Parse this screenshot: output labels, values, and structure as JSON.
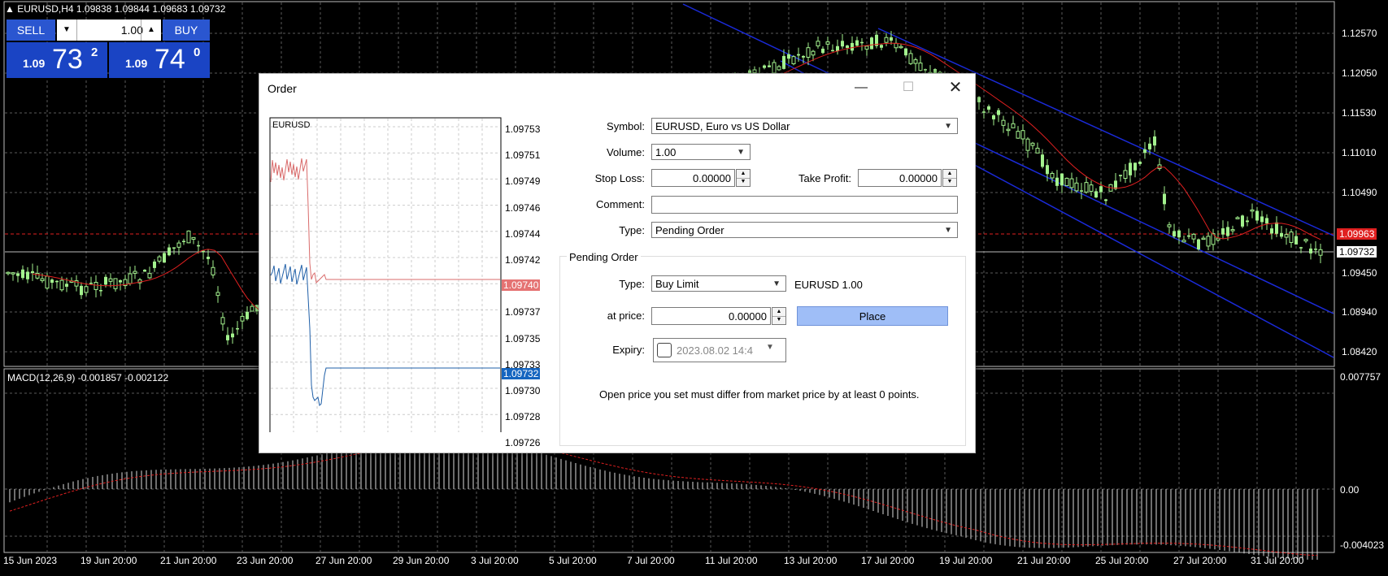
{
  "chart": {
    "header": "▲ EURUSD,H4  1.09838 1.09844 1.09683 1.09732",
    "macd_header": "MACD(12,26,9) -0.001857 -0.002122",
    "price_axis": [
      "1.12570",
      "1.12050",
      "1.11530",
      "1.11010",
      "1.10490",
      "1.09450",
      "1.08940",
      "1.08420"
    ],
    "red_price_tag": "1.09963",
    "white_price_tag": "1.09732",
    "macd_axis": [
      "0.007757",
      "0.00",
      "-0.004023"
    ],
    "time_axis": [
      "15 Jun 2023",
      "19 Jun 20:00",
      "21 Jun 20:00",
      "23 Jun 20:00",
      "27 Jun 20:00",
      "29 Jun 20:00",
      "3 Jul 20:00",
      "5 Jul 20:00",
      "7 Jul 20:00",
      "11 Jul 20:00",
      "13 Jul 20:00",
      "17 Jul 20:00",
      "19 Jul 20:00",
      "21 Jul 20:00",
      "25 Jul 20:00",
      "27 Jul 20:00",
      "31 Jul 20:00"
    ],
    "colors": {
      "bull": "#a3f28e",
      "bear": "#a3f28e",
      "ma": "#e02020",
      "channel": "#1a2ad8",
      "grid": "#5a5a5a"
    }
  },
  "oneclick": {
    "sell_label": "SELL",
    "buy_label": "BUY",
    "lot": "1.00",
    "sell_small": "1.09",
    "sell_big": "73",
    "sell_sup": "2",
    "buy_small": "1.09",
    "buy_big": "74",
    "buy_sup": "0"
  },
  "dialog": {
    "title": "Order",
    "mini_chart": {
      "symbol": "EURUSD",
      "ticks": [
        "1.09753",
        "1.09751",
        "1.09749",
        "1.09746",
        "1.09744",
        "1.09742",
        "1.09740",
        "1.09737",
        "1.09735",
        "1.09733",
        "1.09730",
        "1.09728",
        "1.09726"
      ],
      "ask_tag": "1.09740",
      "bid_tag": "1.09732"
    },
    "symbol_label": "Symbol:",
    "symbol_value": "EURUSD, Euro vs US Dollar",
    "volume_label": "Volume:",
    "volume_value": "1.00",
    "stop_loss_label": "Stop Loss:",
    "stop_loss_value": "0.00000",
    "take_profit_label": "Take Profit:",
    "take_profit_value": "0.00000",
    "comment_label": "Comment:",
    "comment_value": "",
    "type_label": "Type:",
    "type_value": "Pending Order",
    "pending_group_title": "Pending Order",
    "pending_type_label": "Type:",
    "pending_type_value": "Buy Limit",
    "pending_symbol_volume": "EURUSD 1.00",
    "at_price_label": "at price:",
    "at_price_value": "0.00000",
    "place_label": "Place",
    "expiry_label": "Expiry:",
    "expiry_value": "2023.08.02 14:4",
    "info": "Open price you set must differ from market price by at least 0 points."
  }
}
